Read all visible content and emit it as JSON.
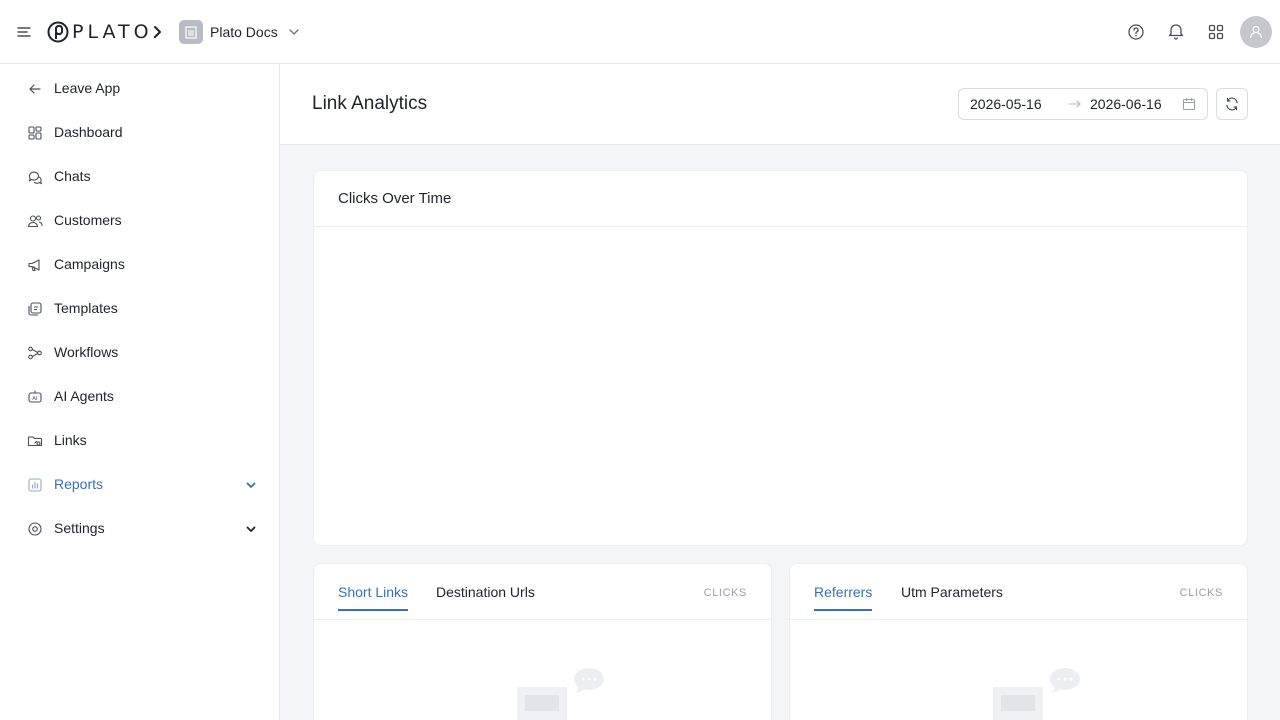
{
  "app": {
    "logo_text": "PLATO",
    "workspace_name": "Plato Docs"
  },
  "sidebar": {
    "items": [
      {
        "label": "Leave App",
        "icon": "arrow-left-icon"
      },
      {
        "label": "Dashboard",
        "icon": "dashboard-icon"
      },
      {
        "label": "Chats",
        "icon": "chat-icon"
      },
      {
        "label": "Customers",
        "icon": "users-icon"
      },
      {
        "label": "Campaigns",
        "icon": "megaphone-icon"
      },
      {
        "label": "Templates",
        "icon": "template-icon"
      },
      {
        "label": "Workflows",
        "icon": "workflow-icon"
      },
      {
        "label": "AI Agents",
        "icon": "ai-agent-icon"
      },
      {
        "label": "Links",
        "icon": "link-folder-icon"
      },
      {
        "label": "Reports",
        "icon": "bar-chart-icon",
        "active": true
      },
      {
        "label": "Settings",
        "icon": "gear-icon"
      }
    ]
  },
  "page": {
    "title": "Link Analytics",
    "date_start": "2026-05-16",
    "date_end": "2026-06-16"
  },
  "chart_card": {
    "title": "Clicks Over Time"
  },
  "left_card": {
    "tabs": [
      "Short Links",
      "Destination Urls"
    ],
    "column_header": "CLICKS"
  },
  "right_card": {
    "tabs": [
      "Referrers",
      "Utm Parameters"
    ],
    "column_header": "CLICKS"
  },
  "colors": {
    "accent": "#3b6fb6",
    "border": "#e6e8eb",
    "background": "#f4f5f6"
  }
}
